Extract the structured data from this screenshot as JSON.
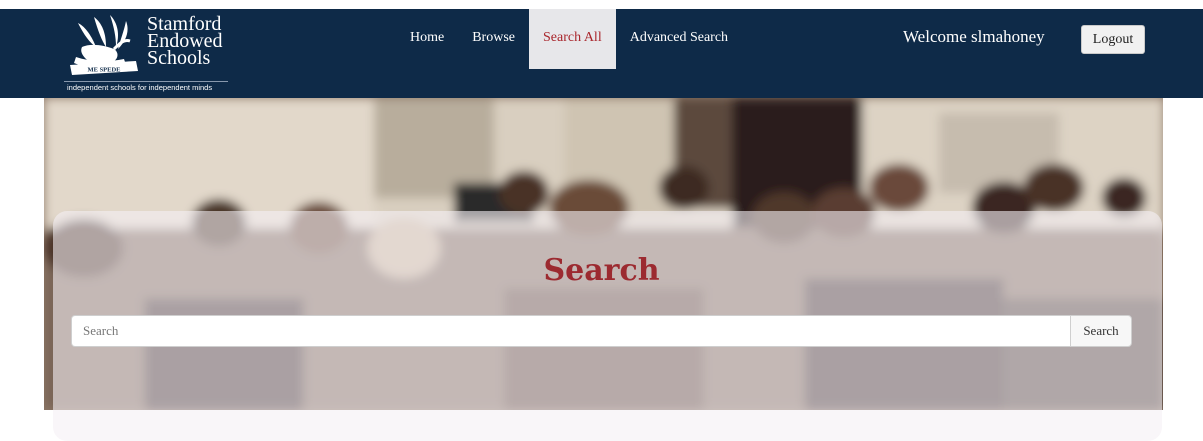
{
  "brand": {
    "name_lines": [
      "Stamford",
      "Endowed",
      "Schools"
    ],
    "motto": "ME SPEDE",
    "tagline": "independent schools for independent minds"
  },
  "nav": {
    "items": [
      {
        "label": "Home",
        "active": false
      },
      {
        "label": "Browse",
        "active": false
      },
      {
        "label": "Search All",
        "active": true
      },
      {
        "label": "Advanced Search",
        "active": false
      }
    ],
    "welcome": "Welcome slmahoney",
    "logout_label": "Logout"
  },
  "hero": {
    "image": "classroom-photo"
  },
  "search": {
    "title": "Search",
    "placeholder": "Search",
    "value": "",
    "button_label": "Search"
  },
  "colors": {
    "navbar": "#0e2a48",
    "active_tab_bg": "#e7e7ea",
    "accent": "#9c2a30"
  }
}
